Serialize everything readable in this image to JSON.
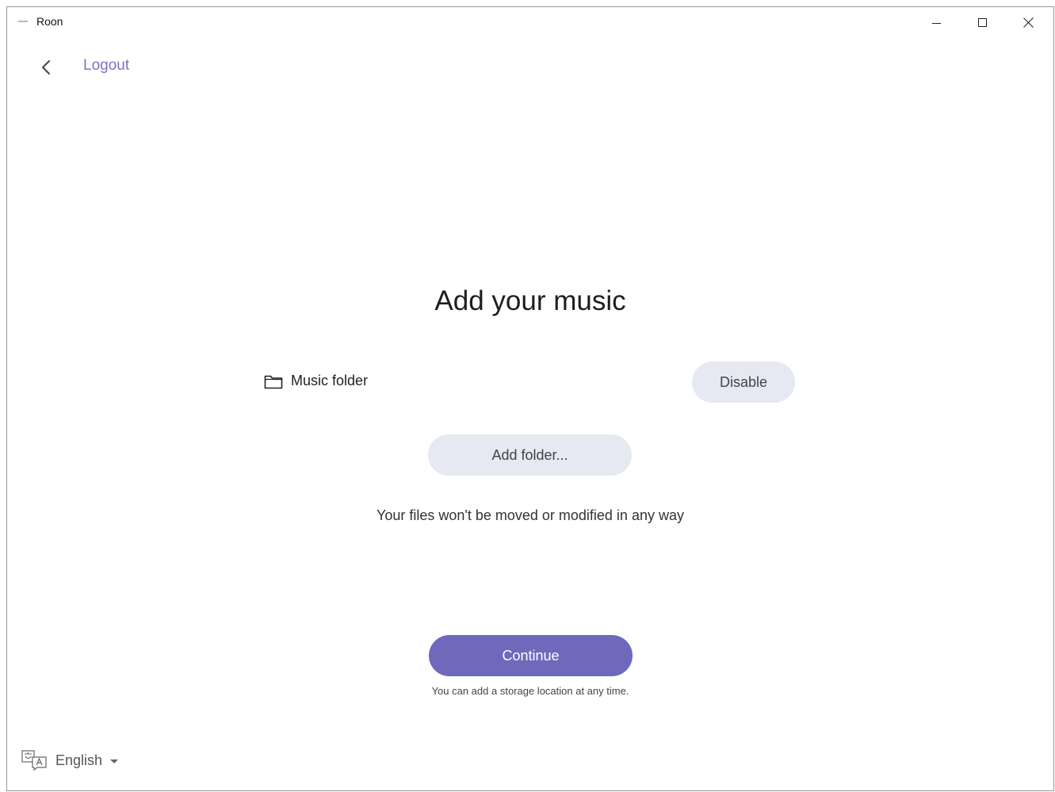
{
  "window": {
    "title": "Roon"
  },
  "nav": {
    "back_icon": "chevron-left-icon",
    "logout_label": "Logout"
  },
  "main": {
    "title": "Add your music",
    "folder": {
      "icon": "folder-icon",
      "label": "Music folder",
      "disable_label": "Disable"
    },
    "add_folder_label": "Add folder...",
    "files_note": "Your files won't be moved or modified in any way",
    "continue_label": "Continue",
    "storage_note": "You can add a storage location at any time."
  },
  "language": {
    "icon": "translate-icon",
    "selected": "English"
  },
  "colors": {
    "accent": "#6e69bb",
    "link": "#7b74c6",
    "secondary_button": "#e6e9f2"
  }
}
